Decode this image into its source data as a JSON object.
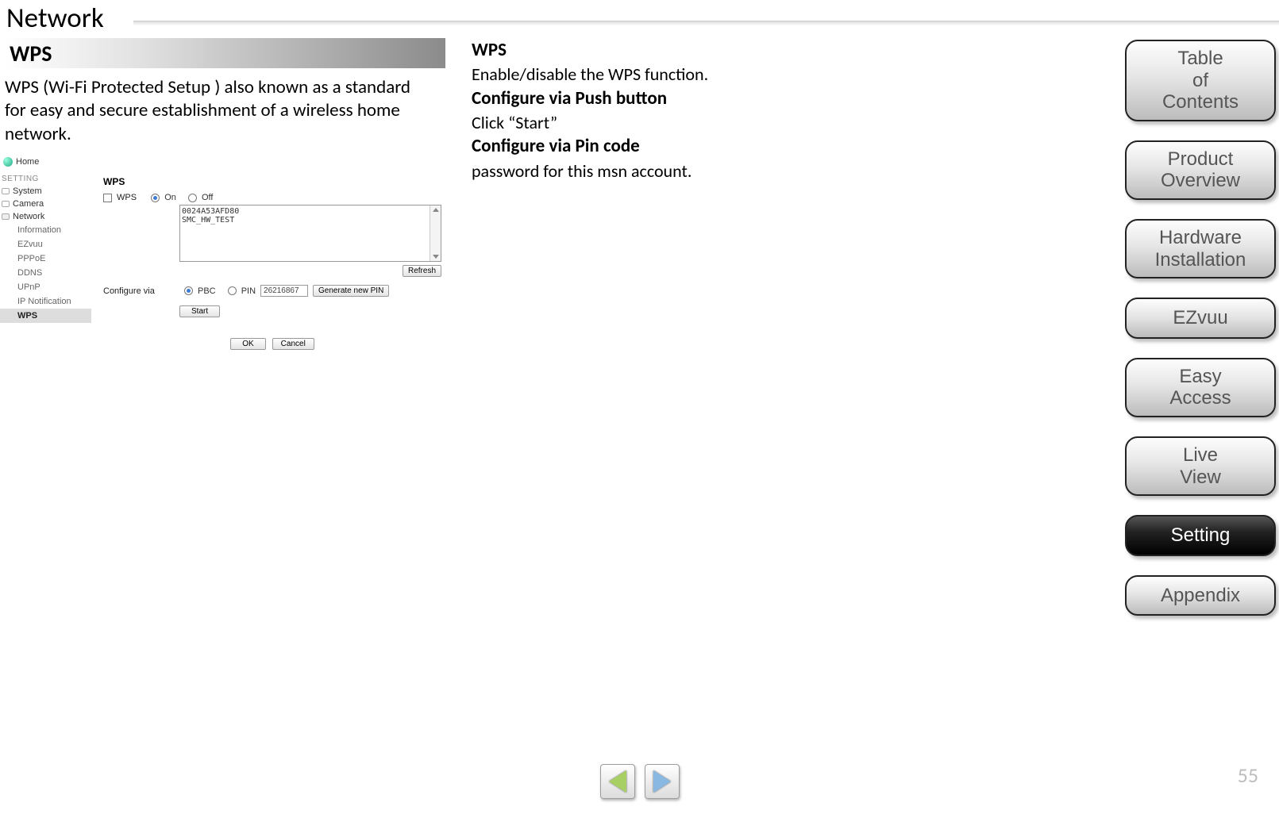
{
  "page": {
    "title": "Network",
    "number": "55"
  },
  "section": {
    "header": "WPS",
    "description": "WPS (Wi-Fi Protected Setup ) also known as a standard for easy and secure establishment of a wireless home network."
  },
  "explanation": {
    "lines": [
      {
        "text": "WPS",
        "bold": true
      },
      {
        "text": "Enable/disable the WPS function.",
        "bold": false
      },
      {
        "text": "Configure via Push button",
        "bold": true
      },
      {
        "text": "Click “Start”",
        "bold": false
      },
      {
        "text": "Configure via Pin code",
        "bold": true
      },
      {
        "text": "password for this msn account.",
        "bold": false
      }
    ]
  },
  "ui": {
    "home": "Home",
    "setting_label": "SETTING",
    "sidebar": {
      "items": [
        {
          "label": "System",
          "expanded": false
        },
        {
          "label": "Camera",
          "expanded": false
        },
        {
          "label": "Network",
          "expanded": true
        }
      ],
      "sub_items": [
        {
          "label": "Information",
          "selected": false
        },
        {
          "label": "EZvuu",
          "selected": false
        },
        {
          "label": "PPPoE",
          "selected": false
        },
        {
          "label": "DDNS",
          "selected": false
        },
        {
          "label": "UPnP",
          "selected": false
        },
        {
          "label": "IP Notification",
          "selected": false
        },
        {
          "label": "WPS",
          "selected": true
        }
      ]
    },
    "main": {
      "title": "WPS",
      "wps_label": "WPS",
      "on_label": "On",
      "off_label": "Off",
      "list_entries": [
        "0024A53AFD80",
        "SMC_HW_TEST"
      ],
      "refresh": "Refresh",
      "configure_label": "Configure via",
      "pbc_label": "PBC",
      "pin_label": "PIN",
      "pin_value": "26216867",
      "generate": "Generate new PIN",
      "start": "Start",
      "ok": "OK",
      "cancel": "Cancel"
    }
  },
  "nav": {
    "items": [
      {
        "label": "Table of Contents",
        "active": false
      },
      {
        "label": "Product Overview",
        "active": false
      },
      {
        "label": "Hardware Installation",
        "active": false
      },
      {
        "label": "EZvuu",
        "active": false
      },
      {
        "label": "Easy Access",
        "active": false
      },
      {
        "label": "Live View",
        "active": false
      },
      {
        "label": "Setting",
        "active": true
      },
      {
        "label": "Appendix",
        "active": false
      }
    ]
  }
}
